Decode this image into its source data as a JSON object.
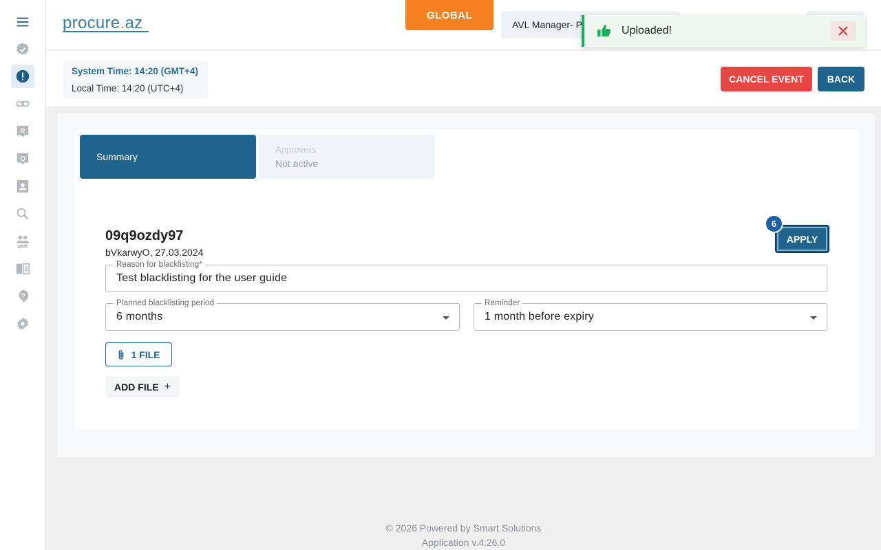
{
  "header": {
    "logo_text": "procure",
    "logo_dot": ".",
    "logo_suffix": "az",
    "global_label": "GLOBAL",
    "role_label": "AVL Manager- P"
  },
  "toast": {
    "message": "Uploaded!",
    "icon": "thumbs-up-icon",
    "accent_color": "#1eae5b"
  },
  "sidebar": {
    "items": [
      {
        "icon": "menu-icon"
      },
      {
        "icon": "verified-badge-icon"
      },
      {
        "icon": "alert-icon",
        "active": true
      },
      {
        "icon": "link-icon"
      },
      {
        "icon": "r-tag-icon"
      },
      {
        "icon": "q-tag-icon"
      },
      {
        "icon": "contact-card-icon"
      },
      {
        "icon": "search-icon"
      },
      {
        "icon": "people-swap-icon"
      },
      {
        "icon": "book-icon"
      },
      {
        "icon": "help-icon"
      },
      {
        "icon": "gear-icon"
      }
    ]
  },
  "timebar": {
    "system_time": "System Time: 14:20 (GMT+4)",
    "local_time": "Local Time: 14:20 (UTC+4)",
    "cancel_label": "CANCEL EVENT",
    "back_label": "BACK"
  },
  "tabs": {
    "summary_label": "Summary",
    "approvers_label": "Approvers",
    "approvers_status": "Not active"
  },
  "event": {
    "id": "09q9ozdy97",
    "meta": "bVkarwyO, 27.03.2024",
    "apply_label": "APPLY",
    "step_number": "6"
  },
  "form": {
    "reason_label": "Reason for blacklisting*",
    "reason_value": "Test blacklisting for the user guide",
    "period_label": "Planned blacklisting period",
    "period_value": "6 months",
    "reminder_label": "Reminder",
    "reminder_value": "1 month before expiry",
    "file_label": "1 FILE",
    "add_file_label": "ADD FILE",
    "add_icon": "+"
  },
  "footer": {
    "line1": "© 2026 Powered by Smart Solutions",
    "line2": "Application v.4.26.0"
  },
  "colors": {
    "primary": "#20648d",
    "orange": "#f5821f",
    "danger": "#e84545",
    "badge": "#1f5fa8"
  }
}
